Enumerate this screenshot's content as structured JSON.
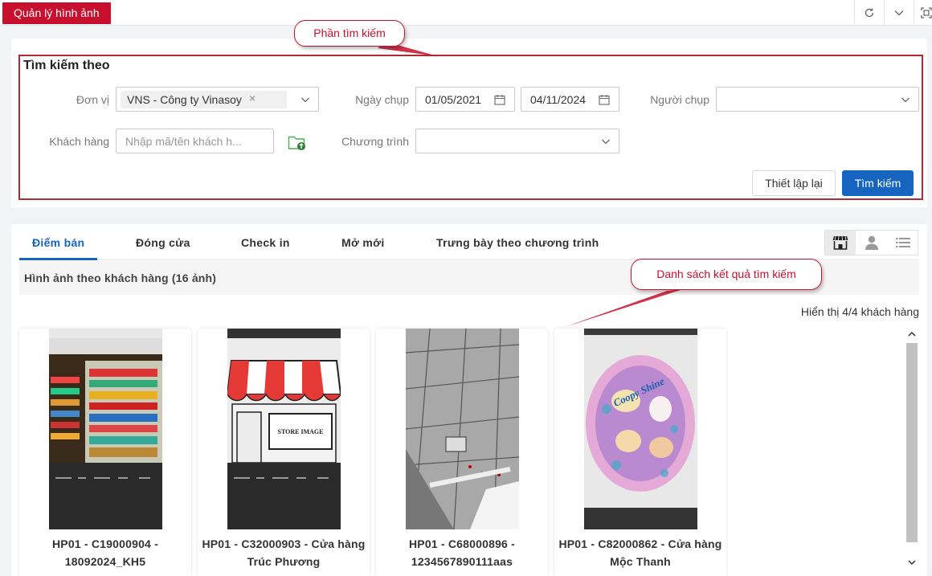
{
  "app": {
    "title": "Quản lý hình ảnh"
  },
  "annotations": {
    "search_callout": "Phần tìm kiếm",
    "results_callout": "Danh sách kết quả tìm kiếm"
  },
  "search": {
    "heading": "Tìm kiếm theo",
    "unit_label": "Đơn vị",
    "unit_value": "VNS - Công ty Vinasoy",
    "unit_remove": "×",
    "date_label": "Ngày chụp",
    "date_from": "01/05/2021",
    "date_to": "04/11/2024",
    "photographer_label": "Người chụp",
    "photographer_value": "",
    "customer_label": "Khách hàng",
    "customer_placeholder": "Nhập mã/tên khách h...",
    "program_label": "Chương trình",
    "program_value": "",
    "reset_label": "Thiết lập lại",
    "search_label": "Tìm kiếm"
  },
  "tabs": [
    {
      "label": "Điểm bán",
      "active": true
    },
    {
      "label": "Đóng cửa",
      "active": false
    },
    {
      "label": "Check in",
      "active": false
    },
    {
      "label": "Mở mới",
      "active": false
    },
    {
      "label": "Trưng bày theo chương trình",
      "active": false
    }
  ],
  "view_switch": [
    "store-icon",
    "person-icon",
    "list-icon"
  ],
  "results": {
    "group_title": "Hình ảnh theo khách hàng (16 ảnh)",
    "showing": "Hiển thị 4/4 khách hàng",
    "cards": [
      {
        "line1": "HP01 - C19000904 -",
        "line2": "18092024_KH5",
        "image": "store-shelves-photo"
      },
      {
        "line1": "HP01 - C32000903 - Cửa hàng",
        "line2": "Trúc Phương",
        "image": "store-image-illustration"
      },
      {
        "line1": "HP01 - C68000896 -",
        "line2": "1234567890111aas",
        "image": "ceiling-photo"
      },
      {
        "line1": "HP01 - C82000862 - Cửa hàng",
        "line2": "Mộc Thanh",
        "image": "sticker-photo"
      }
    ]
  },
  "store_image_text": "STORE IMAGE",
  "sticker_text": "Coopy Shine",
  "colors": {
    "brand_red": "#c8102e",
    "primary_blue": "#1565c0"
  }
}
